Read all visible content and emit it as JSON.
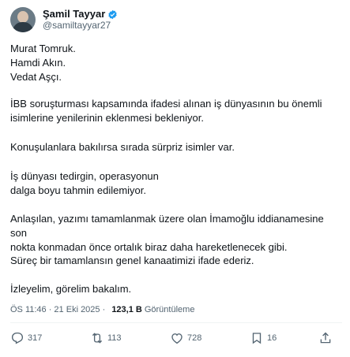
{
  "author": {
    "display_name": "Şamil Tayyar",
    "handle": "@samiltayyar27"
  },
  "tweet": {
    "paragraphs": [
      "Murat Tomruk.\nHamdi Akın.\nVedat Aşçı.",
      "İBB soruşturması kapsamında ifadesi alınan iş dünyasının bu önemli\nisimlerine yenilerinin eklenmesi bekleniyor.",
      "Konuşulanlara bakılırsa sırada sürpriz isimler var.",
      "İş dünyası tedirgin, operasyonun\ndalga boyu tahmin edilemiyor.",
      "Anlaşılan, yazımı tamamlanmak üzere olan İmamoğlu iddianamesine son\nnokta konmadan önce ortalık biraz daha hareketlenecek gibi.",
      "Süreç bir tamamlansın genel kanaatimizi ifade ederiz.",
      "İzleyelim, görelim bakalım."
    ],
    "timestamp": "ÖS 11:46 · 21 Eki 2025 · ",
    "views": "123,1 B",
    "views_label": "Görüntüleme"
  },
  "actions": {
    "replies": "317",
    "reposts": "113",
    "likes": "728",
    "bookmarks": "16"
  },
  "colors": {
    "verified": "#1d9bf0",
    "muted": "#536471",
    "text": "#0f1419"
  },
  "icons": [
    "verified-badge-icon",
    "reply-icon",
    "repost-icon",
    "like-icon",
    "bookmark-icon",
    "share-icon"
  ]
}
